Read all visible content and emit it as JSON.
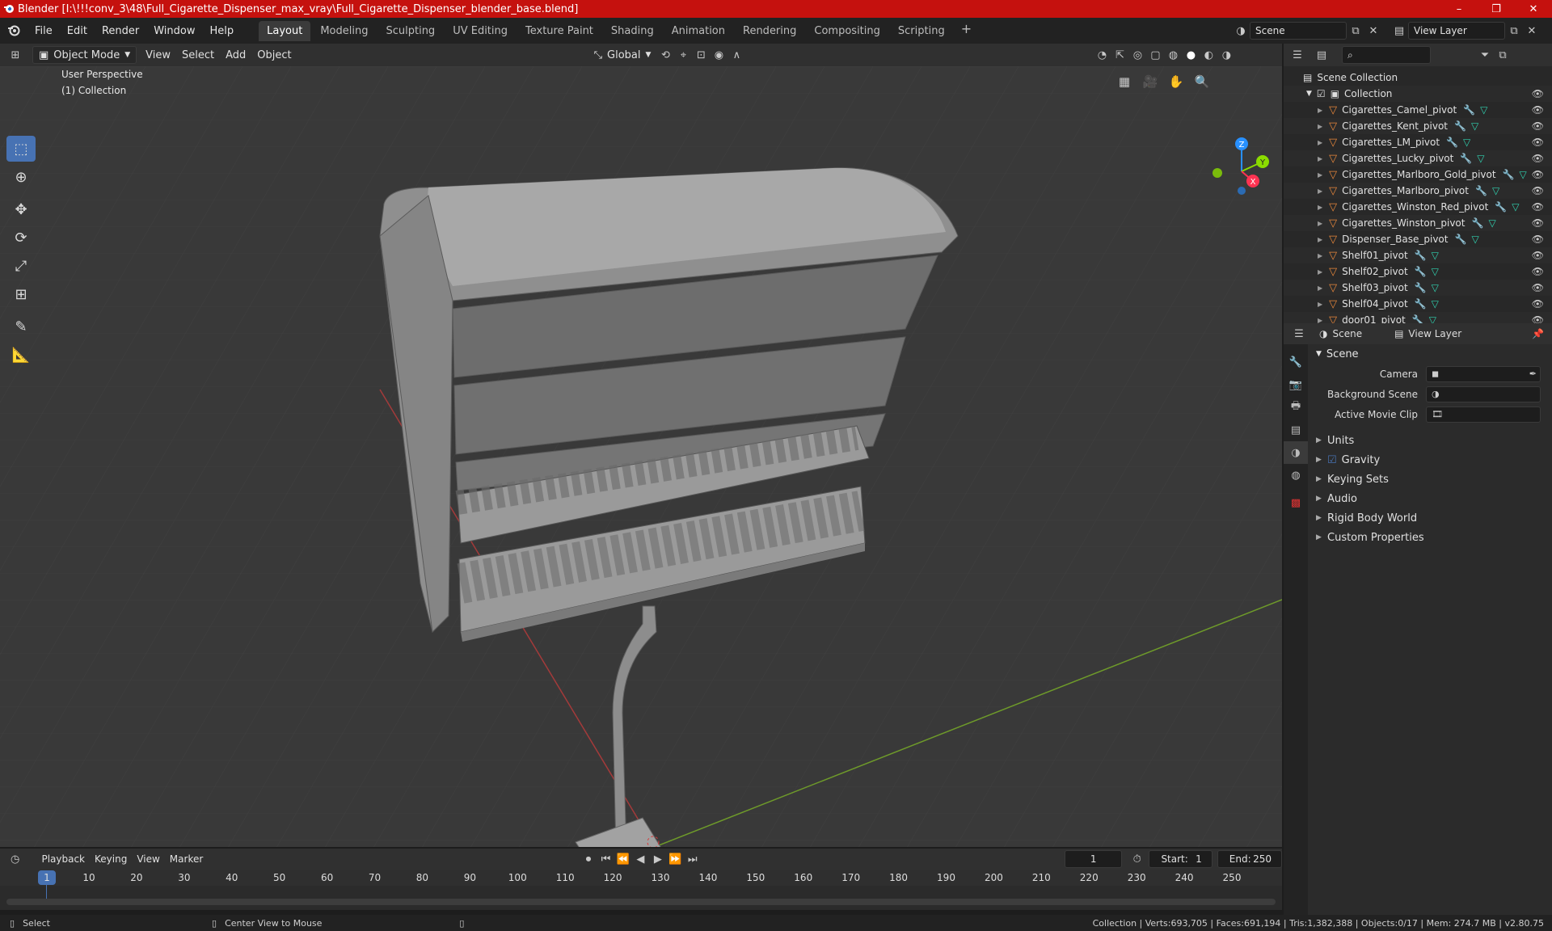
{
  "window": {
    "title": "Blender [I:\\!!!conv_3\\48\\Full_Cigarette_Dispenser_max_vray\\Full_Cigarette_Dispenser_blender_base.blend]",
    "minimize": "–",
    "maximize": "❐",
    "close": "✕"
  },
  "menu": {
    "items": [
      "File",
      "Edit",
      "Render",
      "Window",
      "Help"
    ]
  },
  "workspaces": {
    "tabs": [
      "Layout",
      "Modeling",
      "Sculpting",
      "UV Editing",
      "Texture Paint",
      "Shading",
      "Animation",
      "Rendering",
      "Compositing",
      "Scripting"
    ],
    "active": "Layout",
    "add": "+"
  },
  "scene_selector": {
    "scene": "Scene",
    "view_layer": "View Layer"
  },
  "viewport_header": {
    "mode": "Object Mode",
    "menus": [
      "View",
      "Select",
      "Add",
      "Object"
    ],
    "transform_orientation": "Global"
  },
  "viewport": {
    "perspective": "User Perspective",
    "collection": "(1) Collection",
    "gizmo_axes": [
      "Z",
      "Y",
      "X"
    ]
  },
  "outliner": {
    "root": "Scene Collection",
    "collection": "Collection",
    "objects": [
      "Cigarettes_Camel_pivot",
      "Cigarettes_Kent_pivot",
      "Cigarettes_LM_pivot",
      "Cigarettes_Lucky_pivot",
      "Cigarettes_Marlboro_Gold_pivot",
      "Cigarettes_Marlboro_pivot",
      "Cigarettes_Winston_Red_pivot",
      "Cigarettes_Winston_pivot",
      "Dispenser_Base_pivot",
      "Shelf01_pivot",
      "Shelf02_pivot",
      "Shelf03_pivot",
      "Shelf04_pivot",
      "door01_pivot"
    ]
  },
  "properties": {
    "tabs": [
      "Scene",
      "View Layer"
    ],
    "panel": "Scene",
    "fields": [
      {
        "label": "Camera",
        "value": ""
      },
      {
        "label": "Background Scene",
        "value": ""
      },
      {
        "label": "Active Movie Clip",
        "value": ""
      }
    ],
    "subpanels": [
      "Units",
      "Gravity",
      "Keying Sets",
      "Audio",
      "Rigid Body World",
      "Custom Properties"
    ],
    "gravity_checked": true
  },
  "timeline": {
    "menus": [
      "Playback",
      "Keying",
      "View",
      "Marker"
    ],
    "current_frame": "1",
    "start_label": "Start:",
    "start": "1",
    "end_label": "End:",
    "end": "250",
    "ruler": [
      "1",
      "10",
      "20",
      "30",
      "40",
      "50",
      "60",
      "70",
      "80",
      "90",
      "100",
      "110",
      "120",
      "130",
      "140",
      "150",
      "160",
      "170",
      "180",
      "190",
      "200",
      "210",
      "220",
      "230",
      "240",
      "250"
    ]
  },
  "status": {
    "left": "Select",
    "middle": "Center View to Mouse",
    "right": "Collection | Verts:693,705 | Faces:691,194 | Tris:1,382,388 | Objects:0/17 | Mem: 274.7 MB | v2.80.75"
  },
  "colors": {
    "titlebar": "#c5110e",
    "accent": "#4772b3",
    "object_icon": "#e8873b",
    "mesh_icon": "#31d2b0",
    "axis_x": "#ff3352",
    "axis_y": "#8bdc00",
    "axis_z": "#2890ff"
  }
}
